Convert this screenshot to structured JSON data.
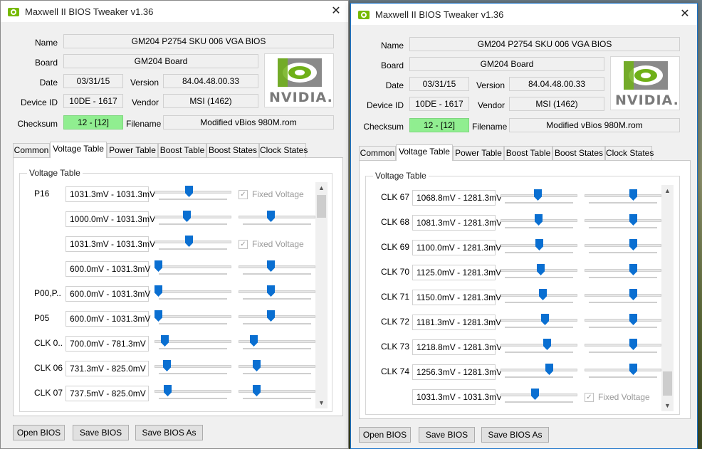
{
  "windows": [
    {
      "title": "Maxwell II BIOS Tweaker v1.36",
      "close": "✕",
      "info": {
        "name_label": "Name",
        "name_value": "GM204 P2754 SKU 006 VGA BIOS",
        "board_label": "Board",
        "board_value": "GM204 Board",
        "date_label": "Date",
        "date_value": "03/31/15",
        "version_label": "Version",
        "version_value": "84.04.48.00.33",
        "device_id_label": "Device ID",
        "device_id_value": "10DE - 1617",
        "vendor_label": "Vendor",
        "vendor_value": "MSI (1462)",
        "checksum_label": "Checksum",
        "checksum_value": "12 - [12]",
        "filename_label": "Filename",
        "filename_value": "Modified vBios 980M.rom",
        "logo_text": "NVIDIA."
      },
      "tabs": [
        "Common",
        "Voltage Table",
        "Power Table",
        "Boost Table",
        "Boost States",
        "Clock States"
      ],
      "active_tab": 1,
      "group_title": "Voltage Table",
      "rows": [
        {
          "label": "P16",
          "value": "1031.3mV - 1031.3mV",
          "slider1": 0.44,
          "slider2": null,
          "fixed": true,
          "fixed_label": "Fixed Voltage"
        },
        {
          "label": "",
          "value": "1000.0mV - 1031.3mV",
          "slider1": 0.41,
          "slider2": 0.41,
          "fixed": false
        },
        {
          "label": "",
          "value": "1031.3mV - 1031.3mV",
          "slider1": 0.44,
          "slider2": null,
          "fixed": true,
          "fixed_label": "Fixed Voltage"
        },
        {
          "label": "",
          "value": "600.0mV - 1031.3mV",
          "slider1": 0.0,
          "slider2": 0.41,
          "fixed": false
        },
        {
          "label": "P00,P..",
          "value": "600.0mV - 1031.3mV",
          "slider1": 0.0,
          "slider2": 0.41,
          "fixed": false
        },
        {
          "label": "P05",
          "value": "600.0mV - 1031.3mV",
          "slider1": 0.0,
          "slider2": 0.41,
          "fixed": false
        },
        {
          "label": "CLK 0..",
          "value": "700.0mV - 781.3mV",
          "slider1": 0.09,
          "slider2": 0.17,
          "fixed": false
        },
        {
          "label": "CLK 06",
          "value": "731.3mV - 825.0mV",
          "slider1": 0.12,
          "slider2": 0.21,
          "fixed": false
        },
        {
          "label": "CLK 07",
          "value": "737.5mV - 825.0mV",
          "slider1": 0.13,
          "slider2": 0.21,
          "fixed": false
        }
      ],
      "buttons": {
        "open": "Open BIOS",
        "save": "Save BIOS",
        "save_as": "Save BIOS As"
      }
    },
    {
      "title": "Maxwell II BIOS Tweaker v1.36",
      "close": "✕",
      "info": {
        "name_label": "Name",
        "name_value": "GM204 P2754 SKU 006 VGA BIOS",
        "board_label": "Board",
        "board_value": "GM204 Board",
        "date_label": "Date",
        "date_value": "03/31/15",
        "version_label": "Version",
        "version_value": "84.04.48.00.33",
        "device_id_label": "Device ID",
        "device_id_value": "10DE - 1617",
        "vendor_label": "Vendor",
        "vendor_value": "MSI (1462)",
        "checksum_label": "Checksum",
        "checksum_value": "12 - [12]",
        "filename_label": "Filename",
        "filename_value": "Modified vBios 980M.rom",
        "logo_text": "NVIDIA."
      },
      "tabs": [
        "Common",
        "Voltage Table",
        "Power Table",
        "Boost Table",
        "Boost States",
        "Clock States"
      ],
      "active_tab": 1,
      "group_title": "Voltage Table",
      "rows": [
        {
          "label": "CLK 67",
          "value": "1068.8mV - 1281.3mV",
          "slider1": 0.48,
          "slider2": 0.65,
          "fixed": false
        },
        {
          "label": "CLK 68",
          "value": "1081.3mV - 1281.3mV",
          "slider1": 0.49,
          "slider2": 0.65,
          "fixed": false
        },
        {
          "label": "CLK 69",
          "value": "1100.0mV - 1281.3mV",
          "slider1": 0.51,
          "slider2": 0.65,
          "fixed": false
        },
        {
          "label": "CLK 70",
          "value": "1125.0mV - 1281.3mV",
          "slider1": 0.53,
          "slider2": 0.65,
          "fixed": false
        },
        {
          "label": "CLK 71",
          "value": "1150.0mV - 1281.3mV",
          "slider1": 0.56,
          "slider2": 0.65,
          "fixed": false
        },
        {
          "label": "CLK 72",
          "value": "1181.3mV - 1281.3mV",
          "slider1": 0.59,
          "slider2": 0.65,
          "fixed": false
        },
        {
          "label": "CLK 73",
          "value": "1218.8mV - 1281.3mV",
          "slider1": 0.62,
          "slider2": 0.65,
          "fixed": false
        },
        {
          "label": "CLK 74",
          "value": "1256.3mV - 1281.3mV",
          "slider1": 0.65,
          "slider2": 0.65,
          "fixed": false
        },
        {
          "label": "",
          "value": "1031.3mV - 1031.3mV",
          "slider1": 0.44,
          "slider2": null,
          "fixed": true,
          "fixed_label": "Fixed Voltage"
        }
      ],
      "buttons": {
        "open": "Open BIOS",
        "save": "Save BIOS",
        "save_as": "Save BIOS As"
      }
    }
  ]
}
